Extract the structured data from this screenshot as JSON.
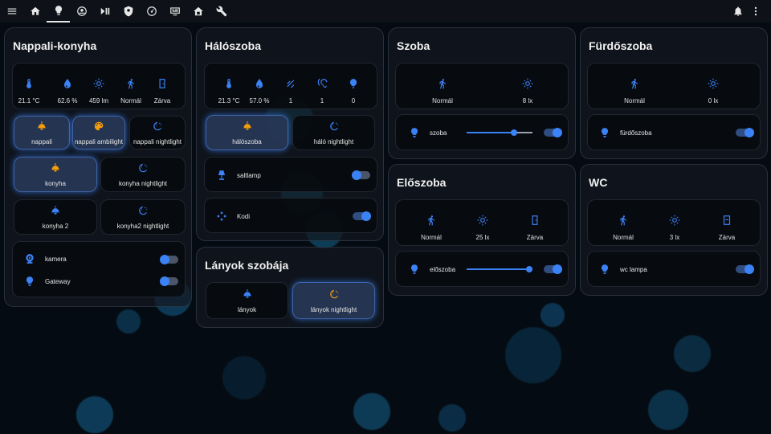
{
  "topbar": {
    "left_icons": [
      "menu-icon",
      "home-icon",
      "lightbulb-icon",
      "robot-vacuum-icon",
      "play-pause-icon",
      "shield-icon",
      "speedometer-icon",
      "monitor-icon",
      "house-icon",
      "wrench-icon"
    ],
    "right_icons": [
      "bell-icon",
      "more-vertical-icon"
    ]
  },
  "colors": {
    "accent": "#3b82f6",
    "active_light": "#f59e0b",
    "bg": "#050b12"
  },
  "rooms": {
    "nappali": {
      "title": "Nappali-konyha",
      "sensors": [
        "21.1 °C",
        "62.6 %",
        "459 lm",
        "Normál",
        "Zárva"
      ],
      "lights": [
        {
          "label": "nappali",
          "state": "on"
        },
        {
          "label": "nappali ambilight",
          "state": "on"
        },
        {
          "label": "nappali nightlight",
          "state": "off"
        },
        {
          "label": "konyha",
          "state": "on"
        },
        {
          "label": "konyha nightlight",
          "state": "off"
        },
        {
          "label": "konyha 2",
          "state": "off"
        },
        {
          "label": "konyha2 nightlight",
          "state": "off"
        }
      ],
      "switches": [
        {
          "label": "kamera",
          "state": "off"
        },
        {
          "label": "Gateway",
          "state": "off"
        }
      ]
    },
    "haloszoba": {
      "title": "Hálószoba",
      "sensors": [
        "21.3 °C",
        "57.0 %",
        "1",
        "1",
        "0"
      ],
      "lights": [
        {
          "label": "hálószoba",
          "state": "on"
        },
        {
          "label": "háló nightlight",
          "state": "off"
        }
      ],
      "switches": [
        {
          "label": "saltlamp",
          "state": "off"
        },
        {
          "label": "Kodi",
          "state": "on"
        }
      ]
    },
    "lanyok": {
      "title": "Lányok szobája",
      "lights": [
        {
          "label": "lányok",
          "state": "off"
        },
        {
          "label": "lányok nightlight",
          "state": "on"
        }
      ]
    },
    "szoba": {
      "title": "Szoba",
      "sensors": [
        "Normál",
        "8 lx"
      ],
      "light": {
        "label": "szoba",
        "brightness": 0.72,
        "state": "on"
      }
    },
    "eloszoba": {
      "title": "Előszoba",
      "sensors": [
        "Normál",
        "25 lx",
        "Zárva"
      ],
      "light": {
        "label": "előszoba",
        "brightness": 1.0,
        "state": "on"
      }
    },
    "furdo": {
      "title": "Fürdőszoba",
      "sensors": [
        "Normál",
        "0 lx"
      ],
      "switch": {
        "label": "fürdőszoba",
        "state": "on"
      }
    },
    "wc": {
      "title": "WC",
      "sensors": [
        "Normál",
        "3 lx",
        "Zárva"
      ],
      "switch": {
        "label": "wc lampa",
        "state": "on"
      }
    }
  }
}
